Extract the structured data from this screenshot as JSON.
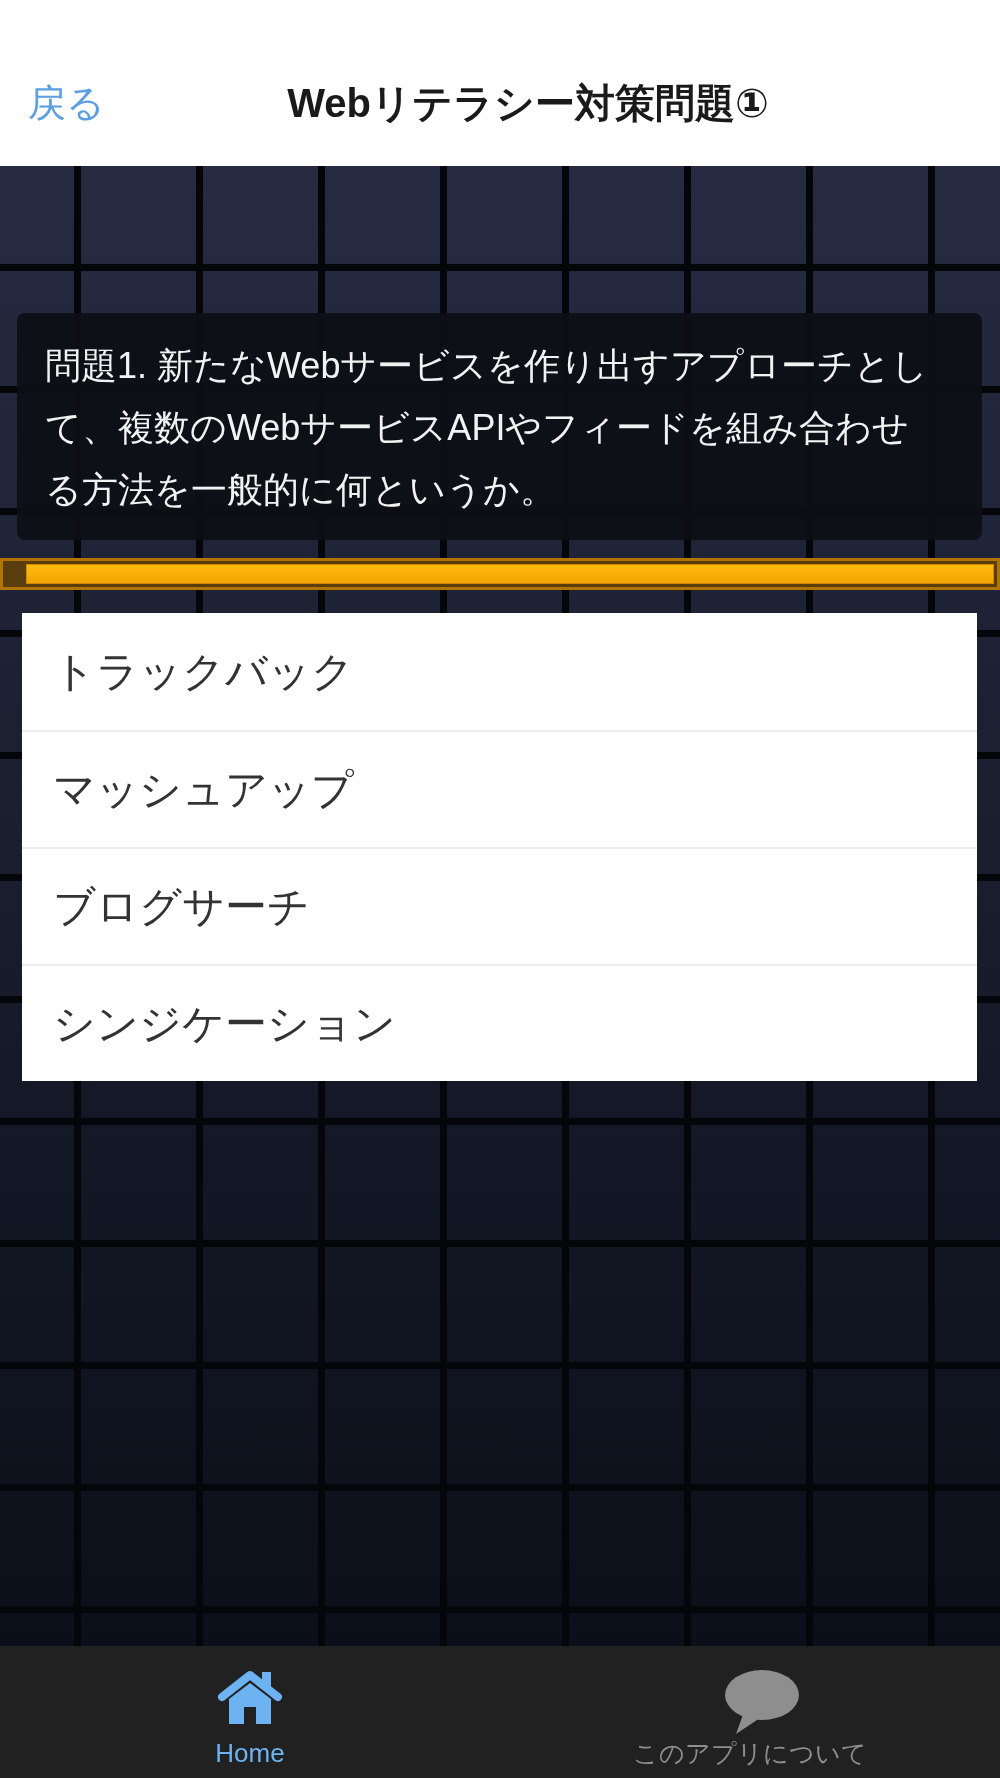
{
  "nav_bar": {
    "back": "戻る",
    "title": "Webリテラシー対策問題①"
  },
  "question": {
    "text": "問題1. 新たなWebサービスを作り出すアプローチとして、複数のWebサービスAPIやフィードを組み合わせる方法を一般的に何というか。"
  },
  "timer": {
    "level": 0.98
  },
  "answers": [
    "トラックバック",
    "マッシュアップ",
    "ブログサーチ",
    "シンジケーション"
  ],
  "tab_bar": {
    "tabs": [
      {
        "label": "Home",
        "kind": "home",
        "selected": true
      },
      {
        "label": "このアプリについて",
        "kind": "chat",
        "selected": false
      }
    ]
  }
}
